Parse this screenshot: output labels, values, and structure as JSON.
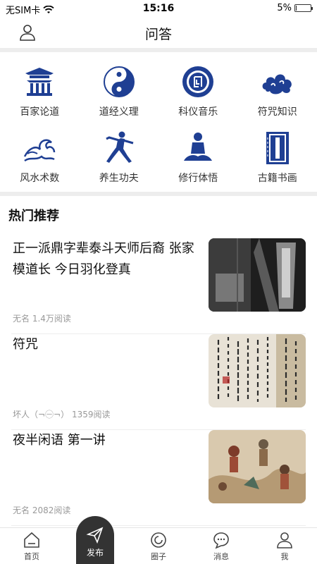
{
  "status_bar": {
    "carrier": "无SIM卡",
    "time": "15:16",
    "battery": "5%",
    "battery_level": 0.05
  },
  "header": {
    "title": "问答"
  },
  "categories": [
    {
      "label": "百家论道",
      "icon": "temple-icon"
    },
    {
      "label": "道经义理",
      "icon": "yin-yang-icon"
    },
    {
      "label": "科仪音乐",
      "icon": "ritual-music-icon"
    },
    {
      "label": "符咒知识",
      "icon": "cloud-charm-icon"
    },
    {
      "label": "风水术数",
      "icon": "wave-icon"
    },
    {
      "label": "养生功夫",
      "icon": "kungfu-icon"
    },
    {
      "label": "修行体悟",
      "icon": "meditation-icon"
    },
    {
      "label": "古籍书画",
      "icon": "ancient-book-icon"
    }
  ],
  "section": {
    "title": "热门推荐"
  },
  "articles": [
    {
      "title": "正一派鼎字辈泰斗天师后裔 张家模道长 今日羽化登真",
      "author": "无名",
      "reads": "1.4万阅读"
    },
    {
      "title": "符咒",
      "author": "坏人（¬㊀¬）",
      "reads": "1359阅读"
    },
    {
      "title": "夜半闲语 第一讲",
      "author": "无名",
      "reads": "2082阅读"
    }
  ],
  "tabbar": {
    "home": "首页",
    "publish": "发布",
    "circle": "圈子",
    "messages": "消息",
    "me": "我"
  },
  "colors": {
    "accent_blue": "#1f3f93",
    "tab_dark": "#333333"
  }
}
